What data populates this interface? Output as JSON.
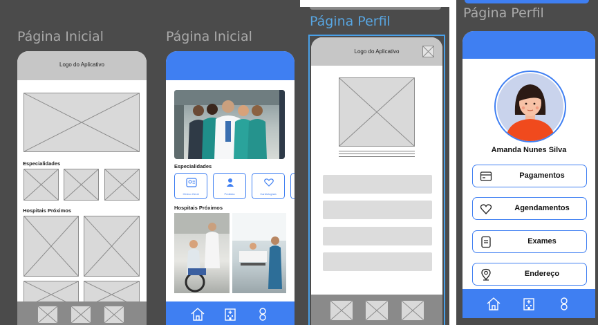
{
  "screens": {
    "wire_home": {
      "title": "Página Inicial",
      "logo_text": "Logo do Aplicativo",
      "specialties_label": "Especialidades",
      "hospitals_label": "Hospitais Próximos"
    },
    "hifi_home": {
      "title": "Página Inicial",
      "specialties_label": "Especialidades",
      "specialties": [
        {
          "label": "Clínico Geral",
          "icon": "id-card-icon"
        },
        {
          "label": "Pediatra",
          "icon": "baby-icon"
        },
        {
          "label": "Cardiologista",
          "icon": "heart-hand-icon"
        }
      ],
      "hospitals_label": "Hospitais Próximos",
      "nav": [
        "home-icon",
        "hospital-icon",
        "profile-icon"
      ]
    },
    "wire_profile": {
      "title": "Página Perfil",
      "logo_text": "Logo do Aplicativo"
    },
    "hifi_profile": {
      "title": "Página Perfil",
      "user_name": "Amanda Nunes Silva",
      "menu": [
        {
          "label": "Pagamentos",
          "icon": "wallet-icon"
        },
        {
          "label": "Agendamentos",
          "icon": "heart-icon"
        },
        {
          "label": "Exames",
          "icon": "document-icon"
        },
        {
          "label": "Endereço",
          "icon": "location-icon"
        }
      ],
      "nav": [
        "home-icon",
        "hospital-icon",
        "profile-icon"
      ]
    }
  },
  "colors": {
    "panel_bg": "#4b4b4b",
    "accent_blue": "#3f7ff2",
    "active_title": "#58a6e2",
    "wire_gray": "#d9d9d9",
    "avatar_bg": "#c9d3ec",
    "avatar_shirt": "#f04a1d"
  }
}
